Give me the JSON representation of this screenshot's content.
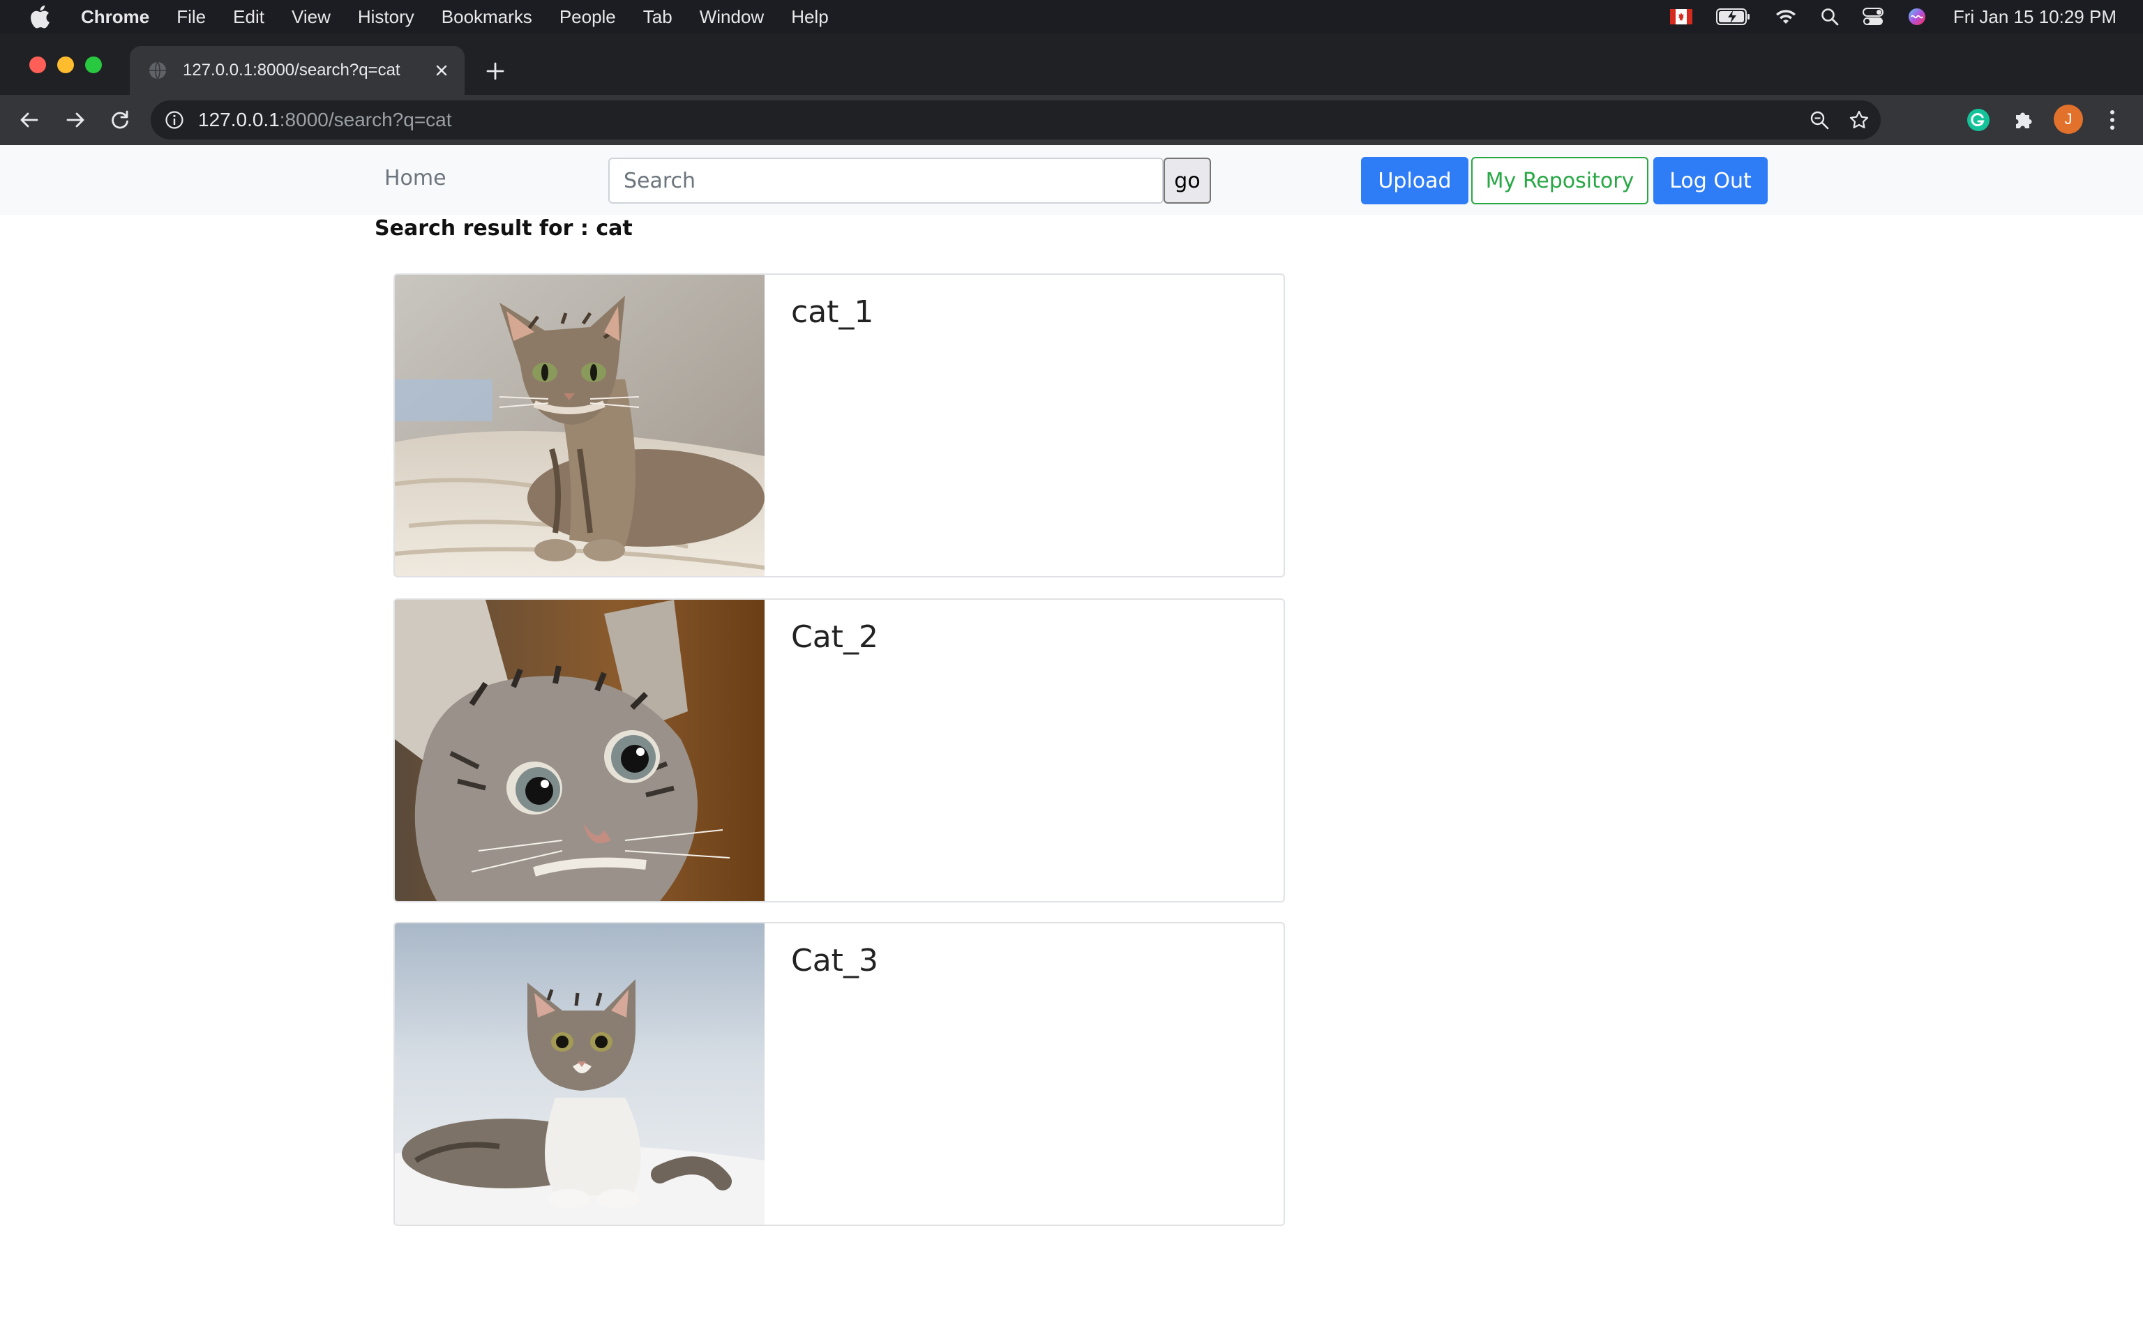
{
  "menubar": {
    "app_name": "Chrome",
    "items": [
      "File",
      "Edit",
      "View",
      "History",
      "Bookmarks",
      "People",
      "Tab",
      "Window",
      "Help"
    ],
    "clock": "Fri Jan 15  10:29 PM"
  },
  "browser": {
    "tab_title": "127.0.0.1:8000/search?q=cat",
    "url_host": "127.0.0.1",
    "url_rest": ":8000/search?q=cat",
    "profile_initial": "J"
  },
  "nav": {
    "home_label": "Home",
    "search_placeholder": "Search",
    "go_label": "go",
    "upload_label": "Upload",
    "repository_label": "My Repository",
    "logout_label": "Log Out"
  },
  "results": {
    "heading": "Search result for : cat",
    "items": [
      {
        "title": "cat_1"
      },
      {
        "title": "Cat_2"
      },
      {
        "title": "Cat_3"
      }
    ]
  },
  "colors": {
    "primary": "#2f7df6",
    "success": "#28a745",
    "navbar_bg": "#f8f9fa"
  }
}
